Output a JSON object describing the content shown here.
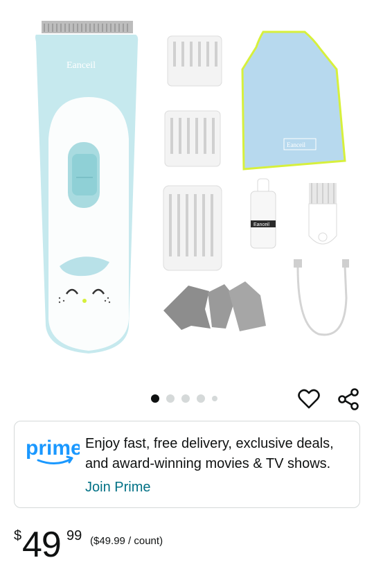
{
  "product_image": {
    "alt_items": [
      "clipper",
      "comb-guards",
      "cape",
      "oil-bottle",
      "cleaning-brush",
      "usb-cable",
      "stencils"
    ],
    "brand_label": "Eanceil"
  },
  "carousel": {
    "count": 5,
    "active": 0
  },
  "prime": {
    "logo_text": "prime",
    "line1": "Enjoy fast, free delivery, exclusive deals,",
    "line2": "and award-winning movies & TV shows.",
    "join_label": "Join Prime"
  },
  "price": {
    "symbol": "$",
    "whole": "49",
    "fraction": "99",
    "unit": "($49.99 / count)"
  },
  "colors": {
    "prime_blue": "#1a98ff",
    "link_teal": "#007185",
    "clipper_blue": "#bfe6ec",
    "cape_blue": "#b7d9ee",
    "cape_trim": "#d7f03c"
  }
}
